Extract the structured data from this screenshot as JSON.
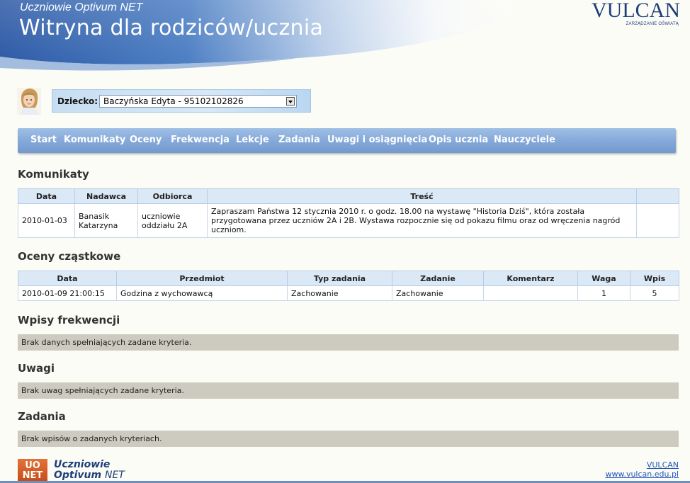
{
  "header": {
    "subtitle": "Uczniowie Optivum NET",
    "title": "Witryna dla rodziców/ucznia",
    "vendor_logo": "VULCAN",
    "vendor_tagline": "ZARZĄDZANIE OŚWIATĄ"
  },
  "child_selector": {
    "label": "Dziecko:",
    "selected": "Baczyńska Edyta - 95102102826",
    "avatar_icon": "child-avatar-icon"
  },
  "nav": {
    "items": [
      {
        "label": "Start"
      },
      {
        "label": "Komunikaty"
      },
      {
        "label": "Oceny"
      },
      {
        "label": "Frekwencja"
      },
      {
        "label": "Lekcje"
      },
      {
        "label": "Zadania"
      },
      {
        "label": "Uwagi i osiągnięcia"
      },
      {
        "label": "Opis ucznia"
      },
      {
        "label": "Nauczyciele"
      }
    ]
  },
  "komunikaty": {
    "title": "Komunikaty",
    "columns": [
      "Data",
      "Nadawca",
      "Odbiorca",
      "Treść",
      ""
    ],
    "rows": [
      {
        "data": "2010-01-03",
        "nadawca": "Banasik Katarzyna",
        "odbiorca": "uczniowie oddziału 2A",
        "tresc": "Zapraszam Państwa 12 stycznia 2010 r. o godz. 18.00 na wystawę \"Historia Dziś\", która została przygotowana przez uczniów 2A i 2B. Wystawa rozpocznie się od pokazu filmu oraz od wręczenia nagród uczniom.",
        "extra": ""
      }
    ]
  },
  "oceny": {
    "title": "Oceny cząstkowe",
    "columns": [
      "Data",
      "Przedmiot",
      "Typ zadania",
      "Zadanie",
      "Komentarz",
      "Waga",
      "Wpis"
    ],
    "rows": [
      {
        "data": "2010-01-09 21:00:15",
        "przedmiot": "Godzina z wychowawcą",
        "typ": "Zachowanie",
        "zadanie": "Zachowanie",
        "komentarz": "",
        "waga": "1",
        "wpis": "5"
      }
    ]
  },
  "frekwencja": {
    "title": "Wpisy frekwencji",
    "empty": "Brak danych spełniających zadane kryteria."
  },
  "uwagi": {
    "title": "Uwagi",
    "empty": "Brak uwag spełniających zadane kryteria."
  },
  "zadania": {
    "title": "Zadania",
    "empty": "Brak wpisów o zadanych kryteriach."
  },
  "footer": {
    "logo_line1": "UO",
    "logo_line2": "NET",
    "name_line1": "Uczniowie",
    "name_line2a": "Optivum",
    "name_line2b": "NET",
    "link1": "VULCAN",
    "link2": "www.vulcan.edu.pl"
  },
  "colors": {
    "nav_bg": "#85a9d9",
    "header_blue": "#2f5fa8",
    "table_header": "#dbe8f6",
    "empty_bar": "#cdcbbf",
    "brand_orange": "#d0561f"
  }
}
